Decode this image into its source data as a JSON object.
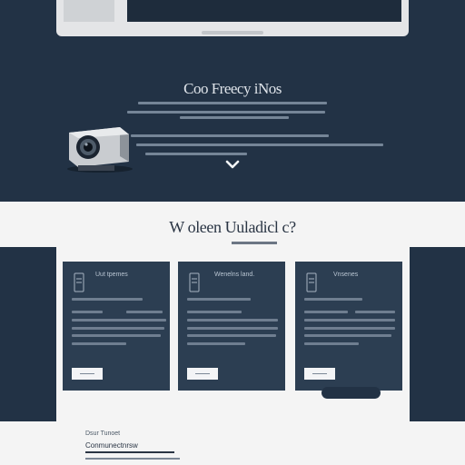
{
  "hero": {
    "title": "Coo Freecy iNos",
    "paragraph_lines": 5
  },
  "section": {
    "title": "W oleen Uuladicl c?"
  },
  "cards": [
    {
      "title": "Uut tpemes",
      "icon": "document-icon",
      "button_label": ""
    },
    {
      "title": "Wenelns land.",
      "icon": "document-icon",
      "button_label": ""
    },
    {
      "title": "Vnsenes",
      "icon": "document-icon",
      "button_label": ""
    }
  ],
  "cta": {
    "label": ""
  },
  "footer": {
    "label": "Dsur Tunoet",
    "link": "Conmunectnrsw"
  },
  "colors": {
    "hero_bg": "#223245",
    "card_bg": "#2c3e52",
    "page_bg": "#f4f4f4"
  }
}
